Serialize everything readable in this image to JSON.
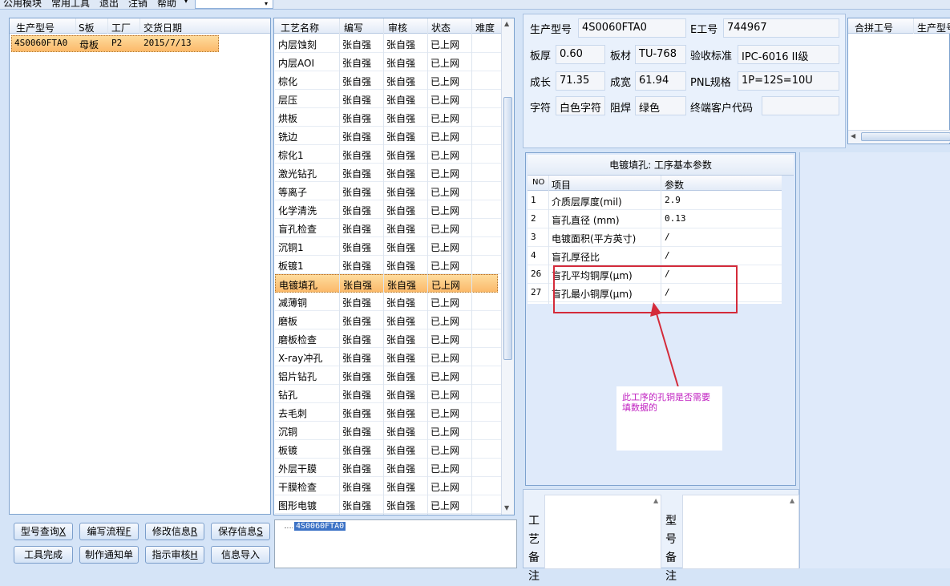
{
  "menu": {
    "items": [
      "公用模块",
      "常用工具",
      "退出",
      "注销",
      "帮助"
    ],
    "combo_arrow": "▾"
  },
  "left_grid": {
    "headers": [
      "生产型号",
      "S板",
      "工厂",
      "交货日期"
    ],
    "rows": [
      [
        "4S0060FTA0",
        "母板",
        "P2",
        "2015/7/13"
      ]
    ],
    "selected_index": 0
  },
  "process_grid": {
    "headers": [
      "工艺名称",
      "编写",
      "审核",
      "状态",
      "难度"
    ],
    "rows": [
      [
        "内层蚀刻",
        "张自强",
        "张自强",
        "已上网",
        ""
      ],
      [
        "内层AOI",
        "张自强",
        "张自强",
        "已上网",
        ""
      ],
      [
        "棕化",
        "张自强",
        "张自强",
        "已上网",
        ""
      ],
      [
        "层压",
        "张自强",
        "张自强",
        "已上网",
        ""
      ],
      [
        "烘板",
        "张自强",
        "张自强",
        "已上网",
        ""
      ],
      [
        "铣边",
        "张自强",
        "张自强",
        "已上网",
        ""
      ],
      [
        "棕化1",
        "张自强",
        "张自强",
        "已上网",
        ""
      ],
      [
        "激光钻孔",
        "张自强",
        "张自强",
        "已上网",
        ""
      ],
      [
        "等离子",
        "张自强",
        "张自强",
        "已上网",
        ""
      ],
      [
        "化学清洗",
        "张自强",
        "张自强",
        "已上网",
        ""
      ],
      [
        "盲孔检查",
        "张自强",
        "张自强",
        "已上网",
        ""
      ],
      [
        "沉铜1",
        "张自强",
        "张自强",
        "已上网",
        ""
      ],
      [
        "板镀1",
        "张自强",
        "张自强",
        "已上网",
        ""
      ],
      [
        "电镀填孔",
        "张自强",
        "张自强",
        "已上网",
        ""
      ],
      [
        "减薄铜",
        "张自强",
        "张自强",
        "已上网",
        ""
      ],
      [
        "磨板",
        "张自强",
        "张自强",
        "已上网",
        ""
      ],
      [
        "磨板检查",
        "张自强",
        "张自强",
        "已上网",
        ""
      ],
      [
        "X-ray冲孔",
        "张自强",
        "张自强",
        "已上网",
        ""
      ],
      [
        "铝片钻孔",
        "张自强",
        "张自强",
        "已上网",
        ""
      ],
      [
        "钻孔",
        "张自强",
        "张自强",
        "已上网",
        ""
      ],
      [
        "去毛刺",
        "张自强",
        "张自强",
        "已上网",
        ""
      ],
      [
        "沉铜",
        "张自强",
        "张自强",
        "已上网",
        ""
      ],
      [
        "板镀",
        "张自强",
        "张自强",
        "已上网",
        ""
      ],
      [
        "外层干膜",
        "张自强",
        "张自强",
        "已上网",
        ""
      ],
      [
        "干膜检查",
        "张自强",
        "张自强",
        "已上网",
        ""
      ],
      [
        "图形电镀",
        "张自强",
        "张自强",
        "已上网",
        ""
      ]
    ],
    "selected_index": 13
  },
  "buttons": {
    "row1": [
      {
        "label": "型号查询",
        "key": "X"
      },
      {
        "label": "编写流程",
        "key": "F"
      },
      {
        "label": "修改信息",
        "key": "R"
      },
      {
        "label": "保存信息",
        "key": "S"
      }
    ],
    "row2": [
      {
        "label": "工具完成",
        "key": ""
      },
      {
        "label": "制作通知单",
        "key": ""
      },
      {
        "label": "指示审核",
        "key": "H"
      },
      {
        "label": "信息导入",
        "key": ""
      }
    ]
  },
  "tree": {
    "node": "4S0060FTA0"
  },
  "info": {
    "model_label": "生产型号",
    "model_value": "4S0060FTA0",
    "e_label": "E工号",
    "e_value": "744967",
    "thickness_label": "板厚",
    "thickness_value": "0.60",
    "material_label": "板材",
    "material_value": "TU-768",
    "standard_label": "验收标准",
    "standard_value": "IPC-6016 II级",
    "length_label": "成长",
    "length_value": "71.35",
    "width_label": "成宽",
    "width_value": "61.94",
    "pnl_label": "PNL规格",
    "pnl_value": "1P=12S=10U",
    "char_label": "字符",
    "char_value": "白色字符",
    "mask_label": "阻焊",
    "mask_value": "绿色",
    "customer_label": "终端客户代码",
    "customer_value": ""
  },
  "merge_grid": {
    "headers": [
      "合拼工号",
      "生产型号"
    ]
  },
  "params": {
    "title": "电镀填孔: 工序基本参数",
    "headers": [
      "NO",
      "项目",
      "参数"
    ],
    "rows": [
      [
        "1",
        "介质层厚度(mil)",
        "2.9"
      ],
      [
        "2",
        "盲孔直径 (mm)",
        "0.13"
      ],
      [
        "3",
        "电镀面积(平方英寸)",
        "/"
      ],
      [
        "4",
        "盲孔厚径比",
        "/"
      ],
      [
        "26",
        "盲孔平均铜厚(μm)",
        "/"
      ],
      [
        "27",
        "盲孔最小铜厚(μm)",
        "/"
      ]
    ]
  },
  "annotation": {
    "text": "此工序的孔铜是否需要填数据的",
    "color": "#d42b3a"
  },
  "remarks": {
    "process_label": [
      "工",
      "艺",
      "备",
      "注"
    ],
    "model_label": [
      "型",
      "号",
      "备",
      "注"
    ]
  },
  "colors": {
    "accent": "#fbb96a",
    "panel_bg": "#d5e4f7",
    "border": "#7da2ce",
    "note_text": "#c020c0"
  }
}
